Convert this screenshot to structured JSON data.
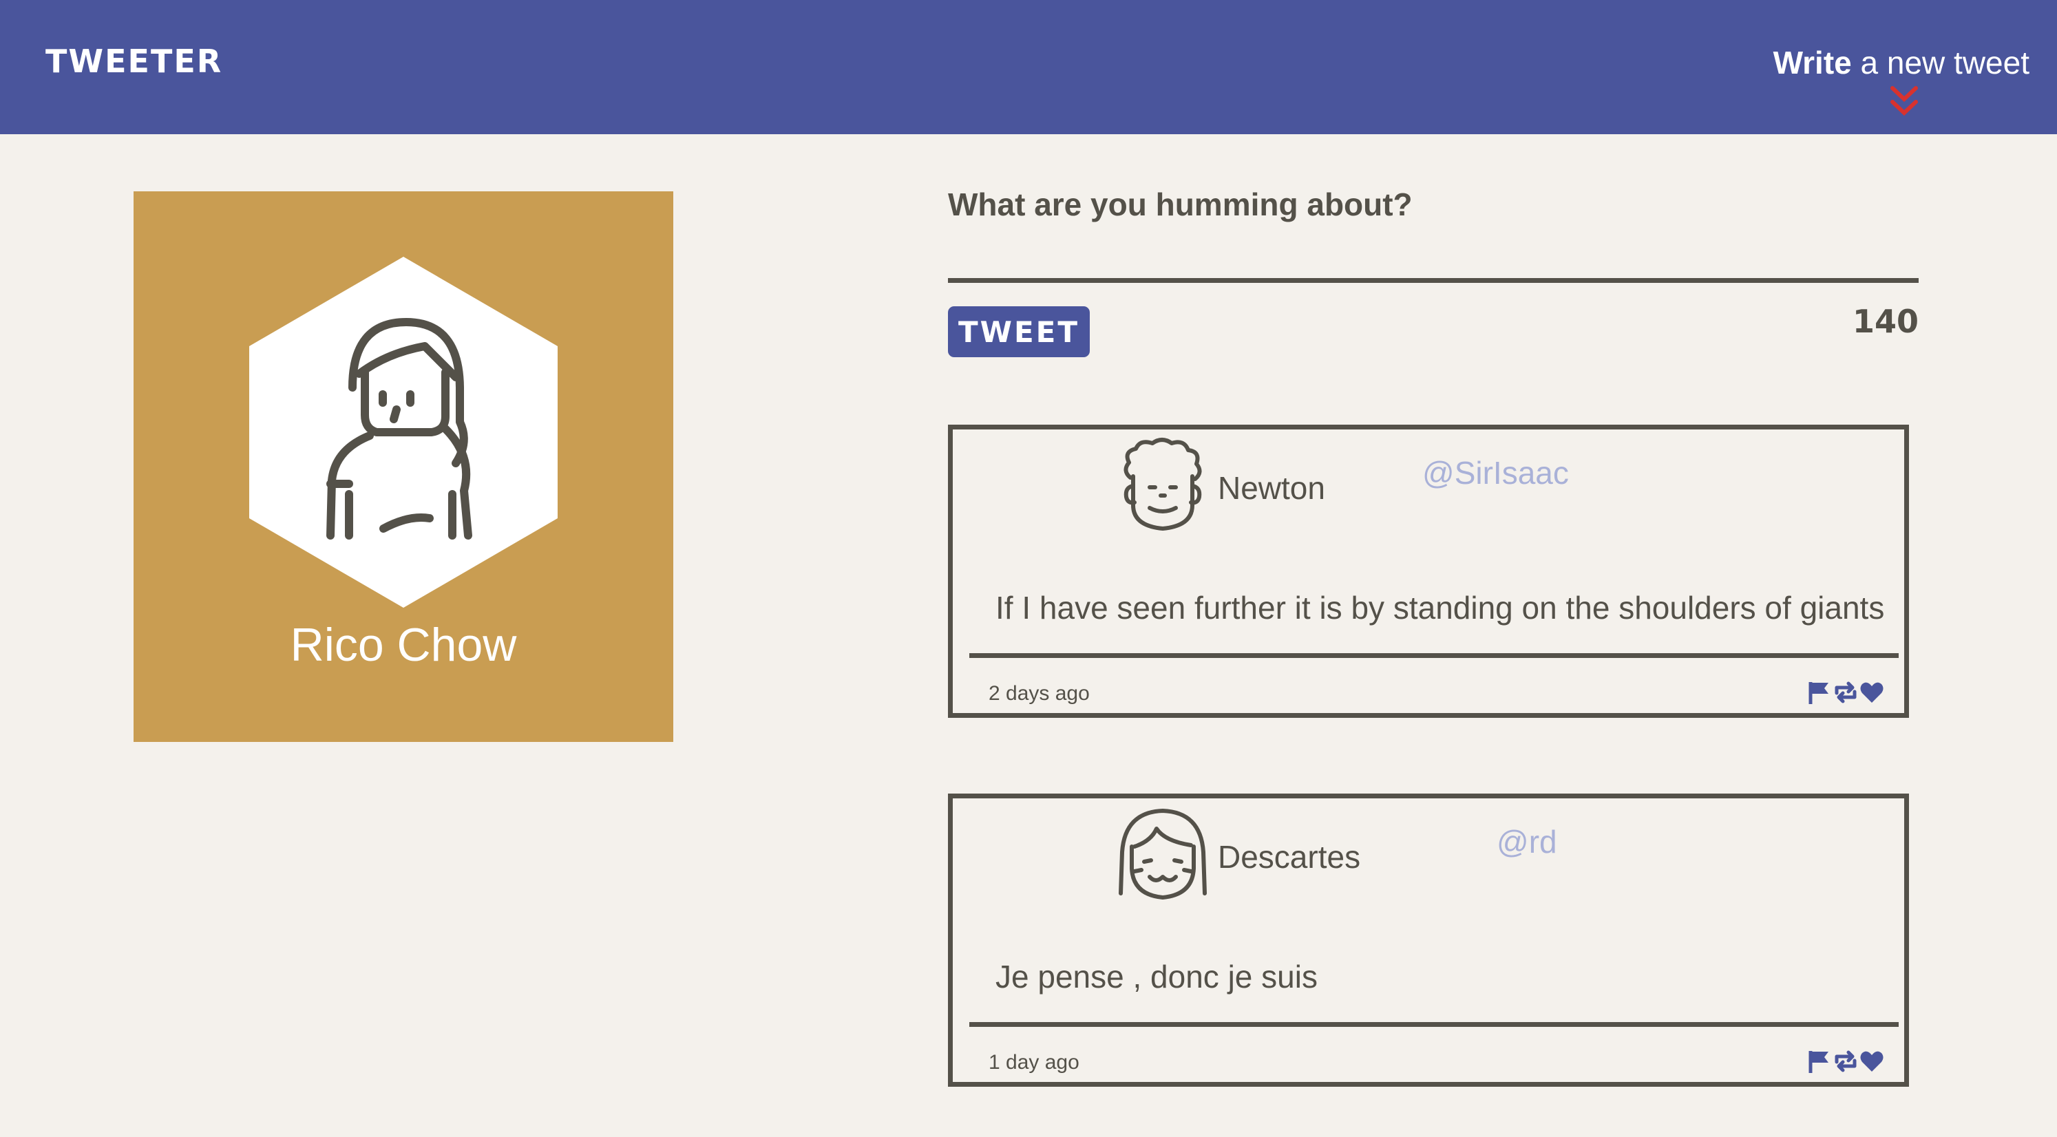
{
  "nav": {
    "brand": "TWEETER",
    "compose_bold": "Write",
    "compose_rest": " a new tweet"
  },
  "profile": {
    "name": "Rico Chow",
    "card_color": "#c99d52"
  },
  "composer": {
    "prompt": "What are you humming about?",
    "button_label": "TWEET",
    "char_count": "140"
  },
  "tweets": [
    {
      "author": "Newton",
      "handle": "@SirIsaac",
      "content": "If I have seen further it is by standing on the shoulders of giants",
      "age": "2 days ago",
      "avatar_icon": "curly-hair-man-icon"
    },
    {
      "author": "Descartes",
      "handle": "@rd",
      "content": "Je pense , donc je suis",
      "age": "1 day ago",
      "avatar_icon": "bob-hair-person-icon"
    }
  ],
  "icons": [
    "flag-icon",
    "retweet-icon",
    "heart-icon"
  ],
  "colors": {
    "nav": "#4a559c",
    "accent_red": "#d8322e",
    "handle": "#a9b1d8",
    "text": "#545149",
    "background": "#f4f1ec"
  }
}
